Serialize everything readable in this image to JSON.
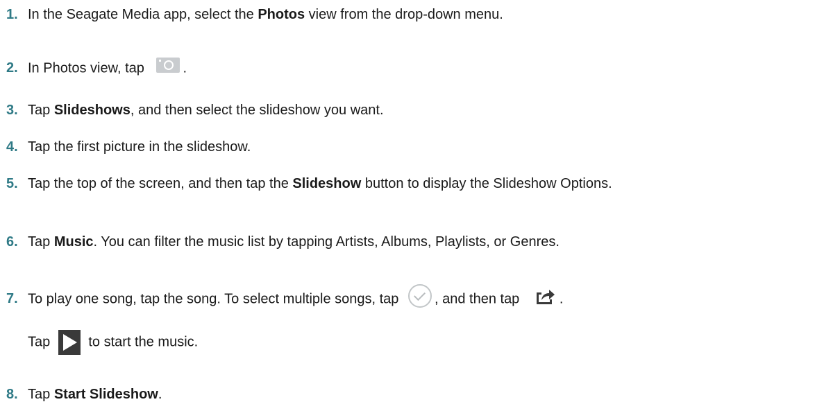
{
  "steps": [
    {
      "num": "1.",
      "pre": "In the Seagate Media app, select the ",
      "bold": "Photos",
      "post": " view from the drop-down menu."
    },
    {
      "num": "2.",
      "pre": "In Photos view, tap ",
      "post": "."
    },
    {
      "num": "3.",
      "pre": "Tap ",
      "bold": "Slideshows",
      "post": ", and then select the slideshow you want."
    },
    {
      "num": "4.",
      "text": "Tap the first picture in the slideshow."
    },
    {
      "num": "5.",
      "pre": "Tap the top of the screen, and then tap the ",
      "bold": "Slideshow",
      "post": " button to display the Slideshow Options."
    },
    {
      "num": "6.",
      "pre": "Tap ",
      "bold": "Music",
      "post": ". You can filter the music list by tapping Artists, Albums, Playlists, or Genres."
    },
    {
      "num": "7.",
      "pre": "To play one song, tap the song. To select multiple songs, tap ",
      "mid": ", and then tap ",
      "post": ".",
      "line2_pre": "Tap ",
      "line2_post": " to start the music."
    },
    {
      "num": "8.",
      "pre": "Tap ",
      "bold": "Start Slideshow",
      "post": "."
    }
  ],
  "icons": {
    "camera": "camera-icon",
    "check": "check-circle-icon",
    "share": "share-icon",
    "play": "play-icon"
  },
  "colors": {
    "step_number": "#2f7a86",
    "text": "#1a1a1a"
  }
}
